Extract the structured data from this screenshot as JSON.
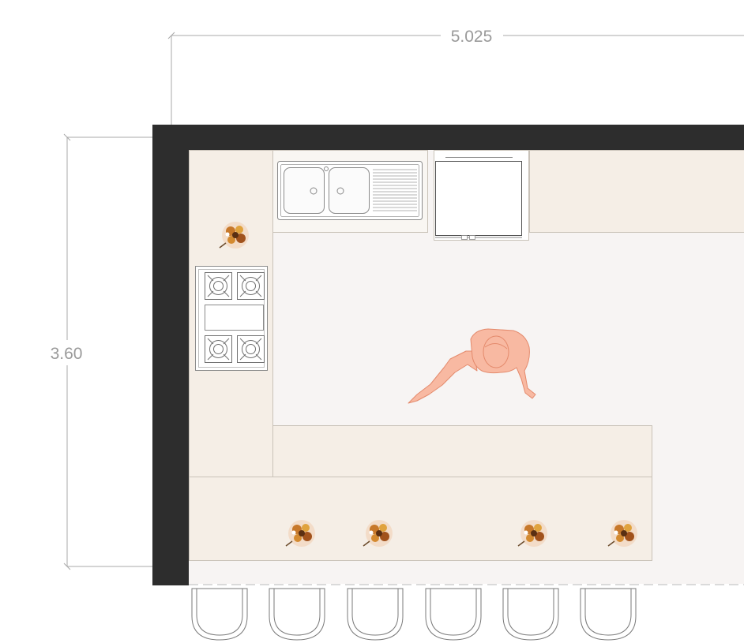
{
  "dimensions": {
    "width_label": "5.025",
    "depth_label": "3.60"
  },
  "colors": {
    "wall": "#2d2d2d",
    "floor": "#f7f4f3",
    "counter": "#f5eee6",
    "counter_stroke": "#c9c2b8",
    "dimension_line": "#a8a8a8",
    "person_fill": "#f8b9a2",
    "person_stroke": "#e48a6c",
    "appliance_stroke": "#8a8a8a"
  },
  "fixtures": {
    "sink": "double-bowl-sink-with-drainboard",
    "fridge": "refrigerator",
    "cooktop": "four-burner-cooktop",
    "plants": "potted-plant-icon",
    "person": "standing-person-icon",
    "stools": "bar-stool-icon"
  }
}
